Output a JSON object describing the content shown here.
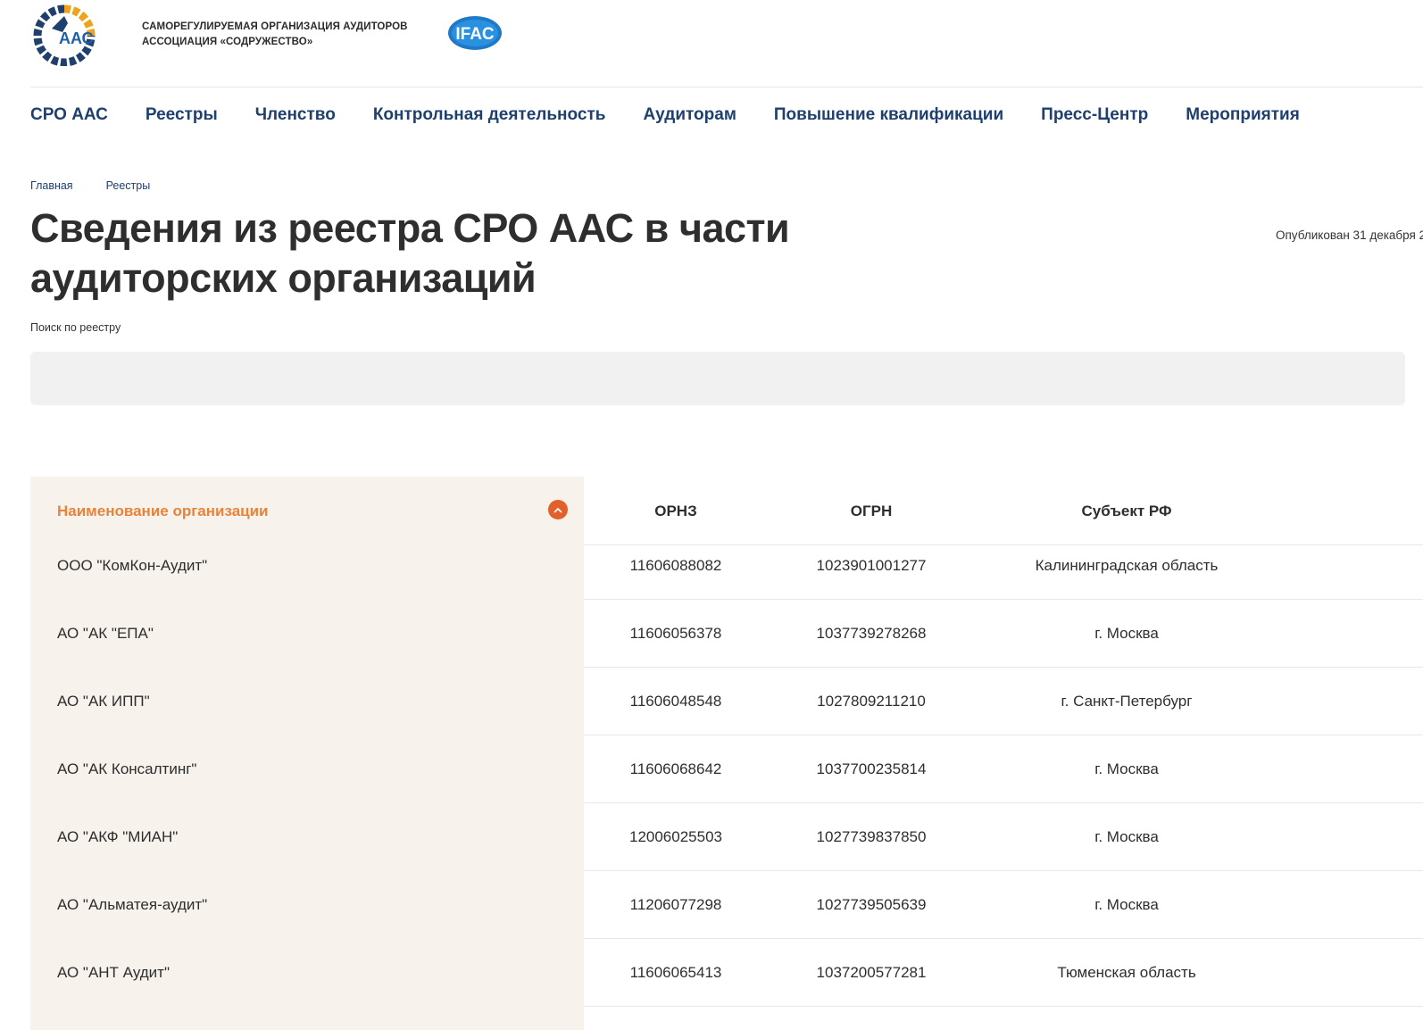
{
  "header": {
    "logo_text": "ААС",
    "org_line1": "САМОРЕГУЛИРУЕМАЯ ОРГАНИЗАЦИЯ АУДИТОРОВ",
    "org_line2": "АССОЦИАЦИЯ «СОДРУЖЕСТВО»",
    "ifac_text": "IFAC"
  },
  "nav": [
    {
      "label": "СРО ААС"
    },
    {
      "label": "Реестры"
    },
    {
      "label": "Членство"
    },
    {
      "label": "Контрольная деятельность"
    },
    {
      "label": "Аудиторам"
    },
    {
      "label": "Повышение квалификации"
    },
    {
      "label": "Пресс-Центр"
    },
    {
      "label": "Мероприятия"
    }
  ],
  "breadcrumb": [
    "Главная",
    "Реестры"
  ],
  "page": {
    "title": "Сведения из реестра СРО ААС в части аудиторских организаций",
    "published": "Опубликован 31 декабря 2"
  },
  "search": {
    "label": "Поиск по реестру",
    "value": "",
    "placeholder": ""
  },
  "table": {
    "columns": [
      "Наименование организации",
      "ОРНЗ",
      "ОГРН",
      "Субъект РФ"
    ],
    "sort_icon": "chevron-up-icon",
    "rows": [
      {
        "name": "ООО \"КомКон-Аудит\"",
        "ornz": "11606088082",
        "ogrn": "1023901001277",
        "subject": "Калининградская область"
      },
      {
        "name": "АО \"АК \"ЕПА\"",
        "ornz": "11606056378",
        "ogrn": "1037739278268",
        "subject": "г. Москва"
      },
      {
        "name": "АО \"АК ИПП\"",
        "ornz": "11606048548",
        "ogrn": "1027809211210",
        "subject": "г. Санкт-Петербург"
      },
      {
        "name": "АО \"АК Консалтинг\"",
        "ornz": "11606068642",
        "ogrn": "1037700235814",
        "subject": "г. Москва"
      },
      {
        "name": "АО \"АКФ \"МИАН\"",
        "ornz": "12006025503",
        "ogrn": "1027739837850",
        "subject": "г. Москва"
      },
      {
        "name": "АО \"Альматея-аудит\"",
        "ornz": "11206077298",
        "ogrn": "1027739505639",
        "subject": "г. Москва"
      },
      {
        "name": "АО \"АНТ Аудит\"",
        "ornz": "11606065413",
        "ogrn": "1037200577281",
        "subject": "Тюменская область"
      }
    ]
  },
  "colors": {
    "brand_blue": "#1f3f6e",
    "accent_orange": "#e8833a",
    "sort_button": "#e2602a",
    "name_column_bg": "#f7f2ec"
  }
}
